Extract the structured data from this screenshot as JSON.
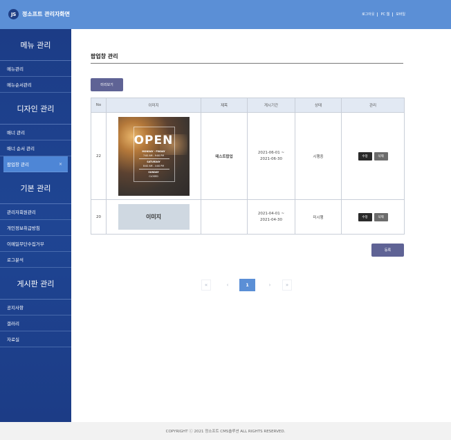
{
  "header": {
    "logo_badge": "JS",
    "logo_text": "정소프트 관리자화면",
    "nav": [
      "로그아웃",
      "PC 웹",
      "모바일"
    ]
  },
  "sidebar": {
    "sections": [
      {
        "title": "메뉴 관리",
        "items": [
          "메뉴관리",
          "메뉴순서관리"
        ]
      },
      {
        "title": "디자인 관리",
        "items": [
          "배너 관리",
          "배너 순서 관리",
          "팝업창 관리"
        ]
      },
      {
        "title": "기본 관리",
        "items": [
          "관리자회원관리",
          "개인정보취급방침",
          "이메일무단수집거부",
          "로그분석"
        ]
      },
      {
        "title": "게시판 관리",
        "items": [
          "공지사항",
          "갤러리",
          "자료실"
        ]
      }
    ],
    "active_item": "팝업창 관리",
    "active_close": "×"
  },
  "main": {
    "page_title": "팝업창 관리",
    "preview_button": "미리보기",
    "register_button": "등록"
  },
  "table": {
    "headers": [
      "No",
      "이미지",
      "제목",
      "게시기간",
      "상태",
      "관리"
    ],
    "rows": [
      {
        "no": "22",
        "image": {
          "word": "OPEN",
          "lines": [
            "MONDAY - FRIDAY",
            "7:00 AM - 9:00 PM",
            "SATURDAY",
            "8:00 AM - 4:00 PM",
            "SUNDAY",
            "CLOSED"
          ]
        },
        "title": "테스트팝업",
        "period_start": "2021-06-01 ~",
        "period_end": "2021-06-30",
        "status": "시행중",
        "edit": "수정",
        "delete": "삭제"
      },
      {
        "no": "20",
        "image_placeholder": "이미지",
        "title": "",
        "period_start": "2021-04-01 ~",
        "period_end": "2021-04-30",
        "status": "미시행",
        "edit": "수정",
        "delete": "삭제"
      }
    ]
  },
  "pagination": {
    "first": "«",
    "prev": "‹",
    "current": "1",
    "next": "›",
    "last": "»"
  },
  "footer": {
    "text": "COPYRIGHT ⓒ 2021 정소프트 CMS솔루션 ALL RIGHTS RESERVED."
  },
  "colors": {
    "header": "#5b8fd6",
    "sidebar": "#1f4593",
    "accent_button": "#5f6395",
    "active_item": "#4e86d6"
  }
}
